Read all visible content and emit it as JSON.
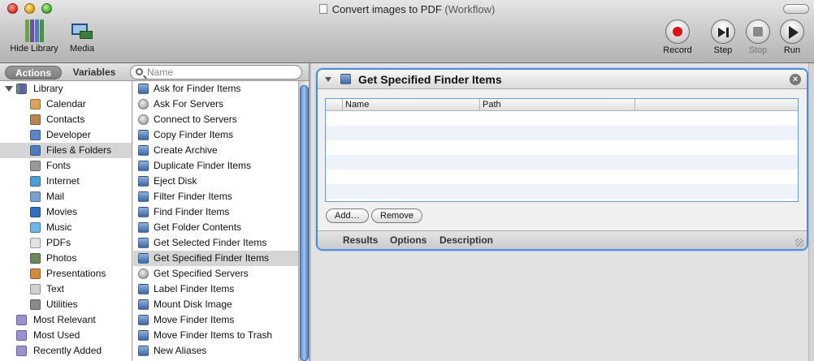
{
  "window": {
    "title": "Convert images to PDF",
    "subtitle": "(Workflow)"
  },
  "toolbar": {
    "hide_library": "Hide Library",
    "media": "Media",
    "record": "Record",
    "step": "Step",
    "stop": "Stop",
    "run": "Run"
  },
  "pane_tabs": {
    "actions": "Actions",
    "variables": "Variables"
  },
  "search": {
    "placeholder": "Name"
  },
  "library": {
    "root": "Library",
    "items": [
      {
        "label": "Calendar",
        "icon": "calendar-icon",
        "color": "#d9a35a"
      },
      {
        "label": "Contacts",
        "icon": "contacts-icon",
        "color": "#b9874c"
      },
      {
        "label": "Developer",
        "icon": "developer-icon",
        "color": "#5a86c8"
      },
      {
        "label": "Files & Folders",
        "icon": "finder-icon",
        "color": "#4f7cbf",
        "selected": true
      },
      {
        "label": "Fonts",
        "icon": "fonts-icon",
        "color": "#9a9a9a"
      },
      {
        "label": "Internet",
        "icon": "internet-icon",
        "color": "#4aa0d8"
      },
      {
        "label": "Mail",
        "icon": "mail-icon",
        "color": "#7aa2cc"
      },
      {
        "label": "Movies",
        "icon": "movies-icon",
        "color": "#2f6fc0"
      },
      {
        "label": "Music",
        "icon": "music-icon",
        "color": "#6fb4e8"
      },
      {
        "label": "PDFs",
        "icon": "pdf-icon",
        "color": "#e2e2e2"
      },
      {
        "label": "Photos",
        "icon": "photos-icon",
        "color": "#6c8b5a"
      },
      {
        "label": "Presentations",
        "icon": "presentations-icon",
        "color": "#d48a3a"
      },
      {
        "label": "Text",
        "icon": "text-icon",
        "color": "#cfcfcf"
      },
      {
        "label": "Utilities",
        "icon": "utilities-icon",
        "color": "#8a8a8a"
      }
    ],
    "smart_groups": [
      {
        "label": "Most Relevant",
        "icon": "smart-folder-icon",
        "color": "#9b8fd6"
      },
      {
        "label": "Most Used",
        "icon": "smart-folder-icon",
        "color": "#9b8fd6"
      },
      {
        "label": "Recently Added",
        "icon": "smart-folder-icon",
        "color": "#9b8fd6"
      }
    ]
  },
  "actions": [
    {
      "label": "Ask for Finder Items",
      "icon": "finder-icon"
    },
    {
      "label": "Ask For Servers",
      "icon": "server-icon"
    },
    {
      "label": "Connect to Servers",
      "icon": "server-icon"
    },
    {
      "label": "Copy Finder Items",
      "icon": "finder-icon"
    },
    {
      "label": "Create Archive",
      "icon": "finder-icon"
    },
    {
      "label": "Duplicate Finder Items",
      "icon": "finder-icon"
    },
    {
      "label": "Eject Disk",
      "icon": "finder-icon"
    },
    {
      "label": "Filter Finder Items",
      "icon": "finder-icon"
    },
    {
      "label": "Find Finder Items",
      "icon": "finder-icon"
    },
    {
      "label": "Get Folder Contents",
      "icon": "finder-icon"
    },
    {
      "label": "Get Selected Finder Items",
      "icon": "finder-icon"
    },
    {
      "label": "Get Specified Finder Items",
      "icon": "finder-icon",
      "selected": true
    },
    {
      "label": "Get Specified Servers",
      "icon": "server-icon"
    },
    {
      "label": "Label Finder Items",
      "icon": "finder-icon"
    },
    {
      "label": "Mount Disk Image",
      "icon": "finder-icon"
    },
    {
      "label": "Move Finder Items",
      "icon": "finder-icon"
    },
    {
      "label": "Move Finder Items to Trash",
      "icon": "finder-icon"
    },
    {
      "label": "New Aliases",
      "icon": "finder-icon"
    }
  ],
  "action_card": {
    "title": "Get Specified Finder Items",
    "columns": [
      "Name",
      "Path"
    ],
    "add_button": "Add…",
    "remove_button": "Remove",
    "footer_tabs": [
      "Results",
      "Options",
      "Description"
    ]
  },
  "colors": {
    "accent": "#4a8ee0",
    "record": "#e0101a"
  }
}
